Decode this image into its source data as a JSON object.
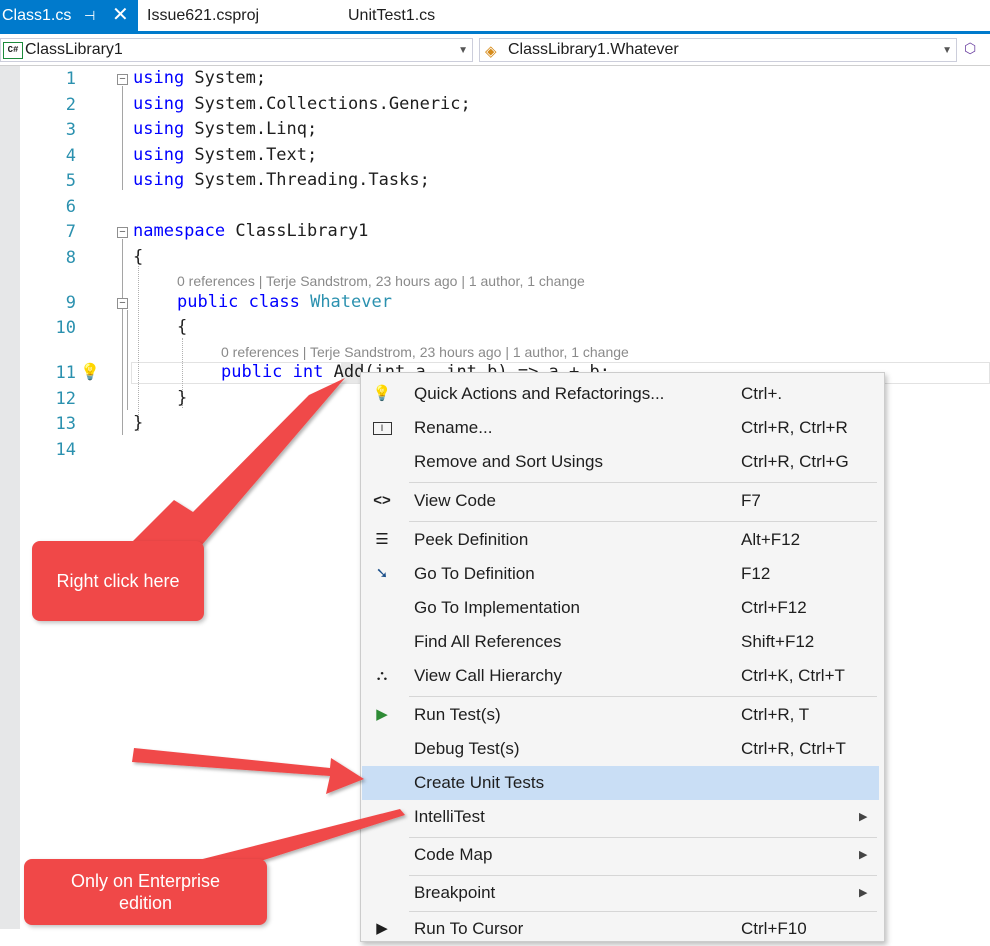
{
  "tabs": [
    {
      "label": "Class1.cs",
      "pin": "⊣",
      "close": "✕"
    },
    {
      "label": "Issue621.csproj"
    },
    {
      "label": "UnitTest1.cs"
    }
  ],
  "navbar": {
    "project_icon": "C#",
    "project": "ClassLibrary1",
    "member": "ClassLibrary1.Whatever"
  },
  "editor": {
    "line_numbers": [
      "1",
      "2",
      "3",
      "4",
      "5",
      "6",
      "7",
      "8",
      "9",
      "10",
      "11",
      "12",
      "13",
      "14"
    ],
    "code": {
      "l1_kw": "using",
      "l1_rest": " System;",
      "l2_kw": "using",
      "l2_rest": " System.Collections.Generic;",
      "l3_kw": "using",
      "l3_rest": " System.Linq;",
      "l4_kw": "using",
      "l4_rest": " System.Text;",
      "l5_kw": "using",
      "l5_rest": " System.Threading.Tasks;",
      "l7_kw": "namespace",
      "l7_rest": " ClassLibrary1",
      "l8": "{",
      "l9_kw": "public class",
      "l9_type": "Whatever",
      "l10": "{",
      "l11_kw": "public int",
      "l11_name": "Add",
      "l11_rest": "(int a, int b) => a + b;",
      "l12": "}",
      "l13": "}"
    },
    "codelens_class": "0 references | Terje Sandstrom, 23 hours ago | 1 author, 1 change",
    "codelens_method": "0 references | Terje Sandstrom, 23 hours ago | 1 author, 1 change"
  },
  "context_menu": {
    "items": [
      {
        "label": "Quick Actions and Refactorings...",
        "shortcut": "Ctrl+.",
        "icon": "lightbulb-icon"
      },
      {
        "label": "Rename...",
        "shortcut": "Ctrl+R, Ctrl+R",
        "icon": "rename-icon"
      },
      {
        "label": "Remove and Sort Usings",
        "shortcut": "Ctrl+R, Ctrl+G"
      },
      {
        "label": "View Code",
        "shortcut": "F7",
        "icon": "code-brackets-icon"
      },
      {
        "label": "Peek Definition",
        "shortcut": "Alt+F12",
        "icon": "peek-icon"
      },
      {
        "label": "Go To Definition",
        "shortcut": "F12",
        "icon": "goto-definition-icon"
      },
      {
        "label": "Go To Implementation",
        "shortcut": "Ctrl+F12"
      },
      {
        "label": "Find All References",
        "shortcut": "Shift+F12"
      },
      {
        "label": "View Call Hierarchy",
        "shortcut": "Ctrl+K, Ctrl+T",
        "icon": "call-hierarchy-icon"
      },
      {
        "label": "Run Test(s)",
        "shortcut": "Ctrl+R, T",
        "icon": "play-icon"
      },
      {
        "label": "Debug Test(s)",
        "shortcut": "Ctrl+R, Ctrl+T"
      },
      {
        "label": "Create Unit Tests",
        "shortcut": "",
        "highlighted": true
      },
      {
        "label": "IntelliTest",
        "shortcut": "",
        "submenu": true
      },
      {
        "label": "Code Map",
        "shortcut": "",
        "submenu": true
      },
      {
        "label": "Breakpoint",
        "shortcut": "",
        "submenu": true
      },
      {
        "label": "Run To Cursor",
        "shortcut": "Ctrl+F10",
        "icon": "run-to-cursor-icon"
      }
    ]
  },
  "callouts": {
    "right_click": "Right click here",
    "enterprise": "Only on Enterprise edition"
  },
  "colors": {
    "accent": "#007acc",
    "keyword": "#0000ff",
    "type": "#2b91af",
    "menu_highlight": "#c9def5",
    "callout": "#f04848"
  }
}
